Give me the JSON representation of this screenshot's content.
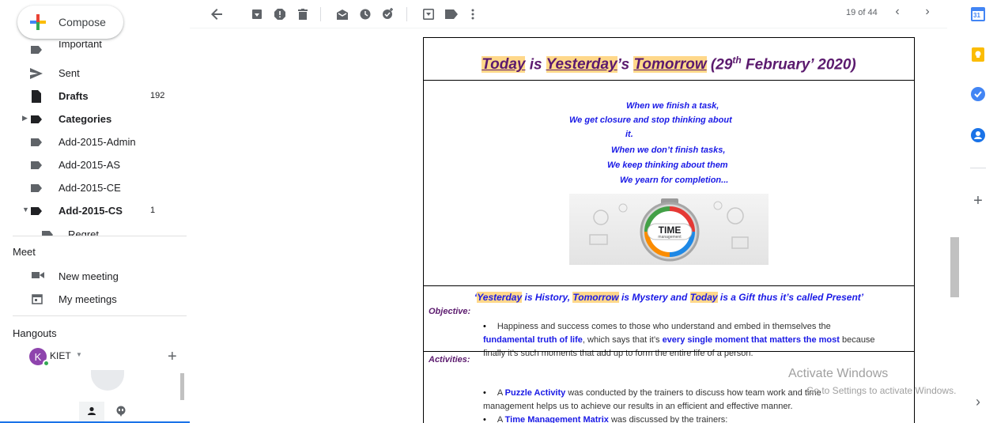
{
  "compose": {
    "label": "Compose"
  },
  "nav": {
    "items": [
      {
        "label": "Important",
        "count": "",
        "bold": false,
        "icon": "important-icon"
      },
      {
        "label": "Sent",
        "count": "",
        "bold": false,
        "icon": "send-icon"
      },
      {
        "label": "Drafts",
        "count": "192",
        "bold": true,
        "icon": "draft-icon"
      },
      {
        "label": "Categories",
        "count": "",
        "bold": true,
        "icon": "label-icon"
      },
      {
        "label": "Add-2015-Admin",
        "count": "",
        "bold": false,
        "icon": "label-icon"
      },
      {
        "label": "Add-2015-AS",
        "count": "",
        "bold": false,
        "icon": "label-icon"
      },
      {
        "label": "Add-2015-CE",
        "count": "",
        "bold": false,
        "icon": "label-icon"
      },
      {
        "label": "Add-2015-CS",
        "count": "1",
        "bold": true,
        "icon": "label-icon"
      },
      {
        "label": "Regret",
        "count": "",
        "bold": false,
        "icon": "label-icon"
      }
    ]
  },
  "meet": {
    "title": "Meet",
    "new_meeting": "New meeting",
    "my_meetings": "My meetings"
  },
  "hangouts": {
    "title": "Hangouts",
    "avatar_letter": "K",
    "user": "KIET"
  },
  "toolbar": {
    "pager": "19 of 44",
    "icons": [
      "back-icon",
      "archive-icon",
      "report-spam-icon",
      "delete-icon",
      "mark-unread-icon",
      "snooze-icon",
      "add-to-tasks-icon",
      "move-to-icon",
      "labels-icon",
      "more-icon"
    ]
  },
  "email": {
    "title_today": "Today",
    "title_is": " is ",
    "title_yesterday": "Yesterday",
    "title_s": "’s ",
    "title_tomorrow": "Tomorrow",
    "title_date_pre": " (29",
    "title_sup": "th",
    "title_date_post": " February’ 2020)",
    "poem": [
      "When we finish a task,",
      "We get closure and stop thinking about",
      "it.",
      "When we don’t finish tasks,",
      "We keep thinking about them",
      "We yearn for completion..."
    ],
    "image_text_main": "TIME",
    "image_text_sub": "management",
    "quote": {
      "p1": "‘",
      "yesterday": "Yesterday",
      "p2": " is History, ",
      "tomorrow": "Tomorrow",
      "p3": " is Mystery and ",
      "today": "Today",
      "p4": " is a Gift thus it’s called Present’"
    },
    "objective_head": "Objective:",
    "objective": {
      "t1": "Happiness and success comes to those who understand and embed in themselves the",
      "b1": "fundamental truth of life",
      "t2": ", which says that it’s ",
      "b2": "every single moment that matters the most",
      "t3": " because",
      "t4": "finally it’s such moments that add up to form the entire life of a person."
    },
    "activities_head": "Activities:",
    "activity1": {
      "t1": "A ",
      "b1": "Puzzle Activity",
      "t2": " was conducted by the trainers to discuss how team work and time",
      "t3": "management helps us to achieve our results in an efficient and effective manner."
    },
    "activity2": {
      "t1": "A ",
      "b1": "Time Management Matrix",
      "t2": " was discussed by the trainers:"
    }
  },
  "watermark": {
    "line1": "Activate Windows",
    "line2": "Go to Settings to activate Windows."
  },
  "right_panel": {
    "icons": [
      "calendar-icon",
      "keep-icon",
      "tasks-icon",
      "contacts-icon",
      "add-icon",
      "expand-icon"
    ],
    "calendar_day": "31"
  },
  "colors": {
    "title_purple": "#5b1a6e",
    "text_blue": "#1a1ae6",
    "highlight": "#ffd88a"
  }
}
